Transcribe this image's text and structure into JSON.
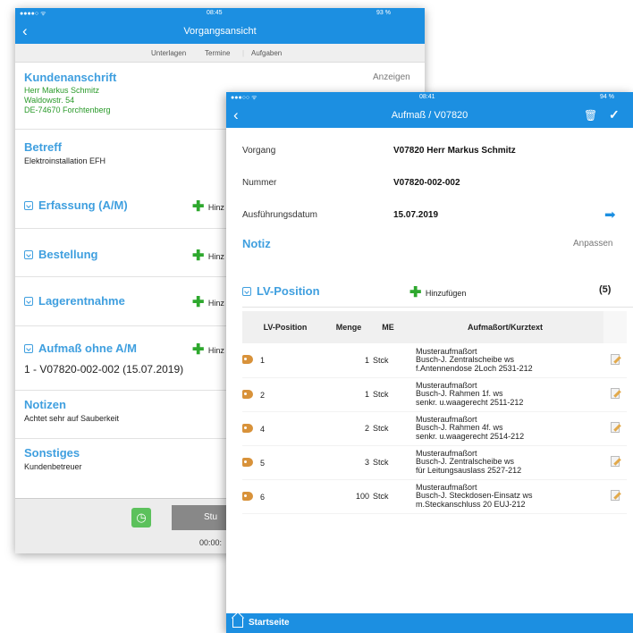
{
  "back": {
    "status": {
      "carrier": "●●●●○ ᯤ",
      "time": "08:45",
      "battery": "93 %"
    },
    "title": "Vorgangsansicht",
    "tabs": [
      "Unterlagen",
      "Termine",
      "Aufgaben"
    ],
    "kundenanschrift": {
      "title": "Kundenanschrift",
      "action": "Anzeigen",
      "lines": [
        "Herr Markus Schmitz",
        "Waldowstr. 54",
        "DE-74670 Forchtenberg"
      ]
    },
    "betreff": {
      "title": "Betreff",
      "text": "Elektroinstallation EFH"
    },
    "sections": [
      {
        "title": "Erfassung (A/M)",
        "add": "Hinz"
      },
      {
        "title": "Bestellung",
        "add": "Hinz"
      },
      {
        "title": "Lagerentnahme",
        "add": "Hinz"
      },
      {
        "title": "Aufmaß ohne A/M",
        "add": "Hinz"
      }
    ],
    "aufmass_entry": "1 - V07820-002-002 (15.07.2019)",
    "notizen": {
      "title": "Notizen",
      "text": "Achtet sehr auf Sauberkeit"
    },
    "sonstiges": {
      "title": "Sonstiges",
      "text": "Kundenbetreuer"
    },
    "stop_label": "Stu",
    "timer": "00:00:"
  },
  "front": {
    "status": {
      "carrier": "●●●○○ ᯤ",
      "time": "08:41",
      "battery": "94 %"
    },
    "title": "Aufmaß / V07820",
    "fields": [
      {
        "label": "Vorgang",
        "value": "V07820 Herr Markus Schmitz"
      },
      {
        "label": "Nummer",
        "value": "V07820-002-002"
      },
      {
        "label": "Ausführungsdatum",
        "value": "15.07.2019"
      }
    ],
    "notiz": {
      "title": "Notiz",
      "action": "Anpassen"
    },
    "lv": {
      "title": "LV-Position",
      "add": "Hinzufügen",
      "count": "(5)"
    },
    "table": {
      "headers": [
        "LV-Position",
        "Menge",
        "ME",
        "Aufmaßort/Kurztext"
      ],
      "rows": [
        {
          "pos": "1",
          "menge": "1",
          "me": "Stck",
          "text": [
            "Musteraufmaßort",
            "Busch-J. Zentralscheibe ws",
            "f.Antennendose 2Loch 2531-212"
          ]
        },
        {
          "pos": "2",
          "menge": "1",
          "me": "Stck",
          "text": [
            "Musteraufmaßort",
            "Busch-J. Rahmen 1f. ws",
            "senkr. u.waagerecht 2511-212"
          ]
        },
        {
          "pos": "4",
          "menge": "2",
          "me": "Stck",
          "text": [
            "Musteraufmaßort",
            "Busch-J. Rahmen 4f. ws",
            "senkr. u.waagerecht 2514-212"
          ]
        },
        {
          "pos": "5",
          "menge": "3",
          "me": "Stck",
          "text": [
            "Musteraufmaßort",
            "Busch-J. Zentralscheibe ws",
            "für Leitungsauslass 2527-212"
          ]
        },
        {
          "pos": "6",
          "menge": "100",
          "me": "Stck",
          "text": [
            "Musteraufmaßort",
            "Busch-J. Steckdosen-Einsatz ws",
            "m.Steckanschluss 20 EUJ-212"
          ]
        }
      ]
    },
    "footer": "Startseite"
  },
  "colors": {
    "accent": "#1c8fe1",
    "section_blue": "#3f9fdf",
    "green": "#2a9a2a",
    "add_green": "#2ea82e"
  }
}
